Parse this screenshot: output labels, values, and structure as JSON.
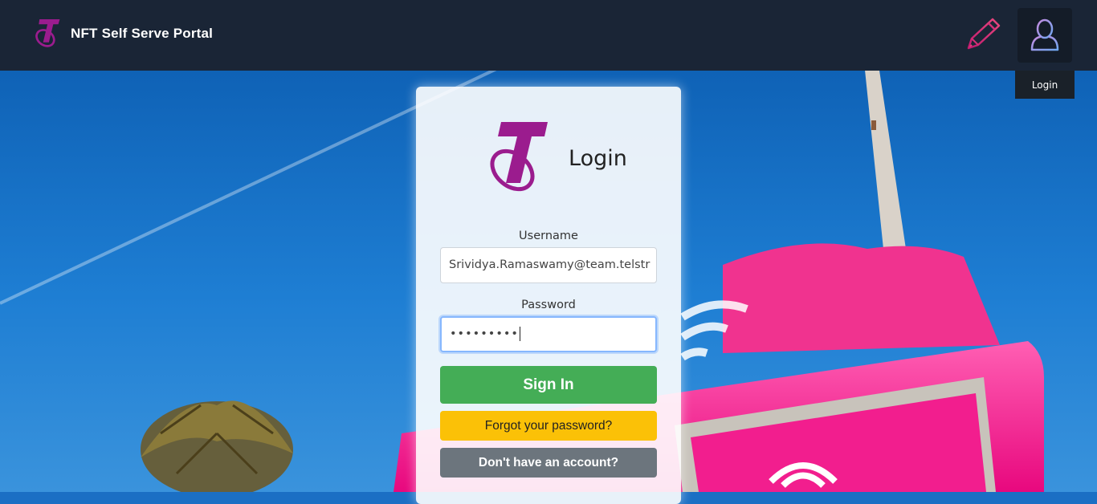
{
  "header": {
    "app_title": "NFT Self Serve Portal",
    "logo_icon": "telstra-logo-icon",
    "edit_icon": "pencil-icon",
    "user_icon": "user-icon",
    "tooltip": "Login"
  },
  "login_card": {
    "title": "Login",
    "username_label": "Username",
    "username_value": "Srividya.Ramaswamy@team.telstr",
    "password_label": "Password",
    "password_masked": "•••••••••",
    "signin_label": "Sign In",
    "forgot_label": "Forgot your password?",
    "account_label": "Don't have an account?"
  },
  "colors": {
    "header_bg": "#1a2536",
    "brand_magenta": "#9b1c8e",
    "signin_green": "#44ad56",
    "forgot_yellow": "#fbc107",
    "account_gray": "#6c757d",
    "sky_blue": "#1c7ad0",
    "booth_pink": "#ec0f84"
  }
}
